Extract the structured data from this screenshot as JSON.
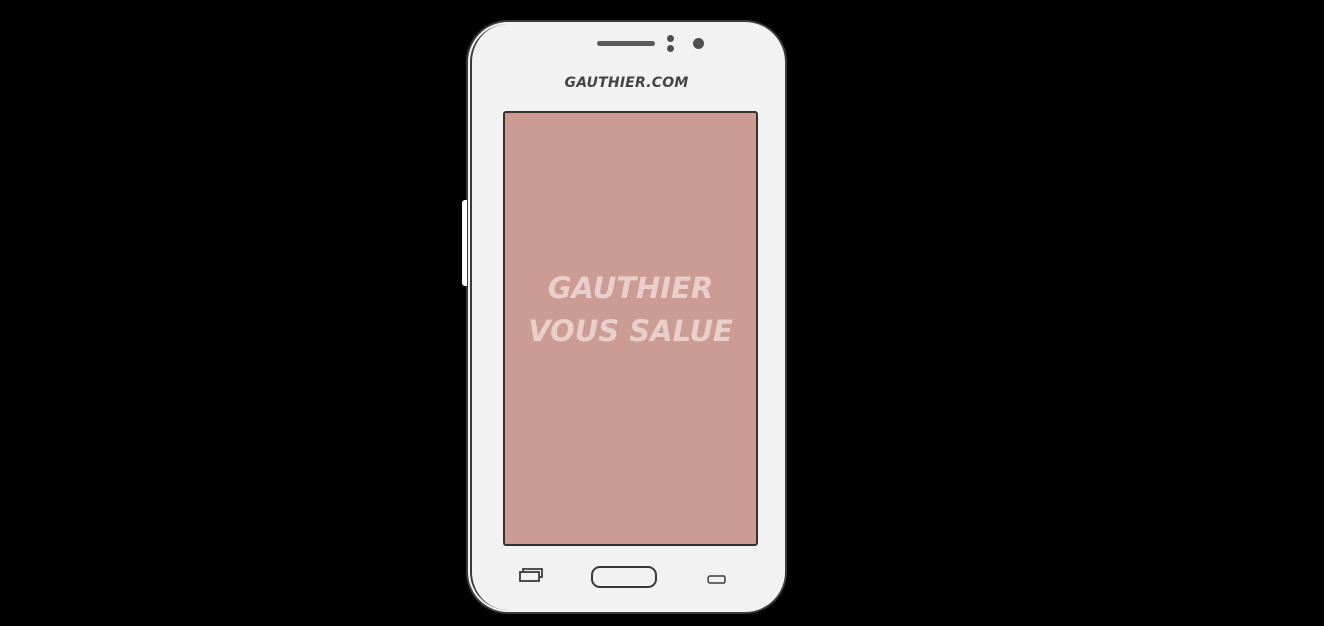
{
  "phone": {
    "brand_label": "GAUTHIER.COM",
    "screen": {
      "background_color": "#cc9b93",
      "lines": [
        "GAUTHIER",
        "VOUS SALUE"
      ]
    }
  },
  "icons": {
    "top": [
      "speaker-grille-icon",
      "sensor-icon",
      "front-camera-icon"
    ],
    "nav": [
      "recent-apps-icon",
      "home-button",
      "back-icon"
    ]
  }
}
